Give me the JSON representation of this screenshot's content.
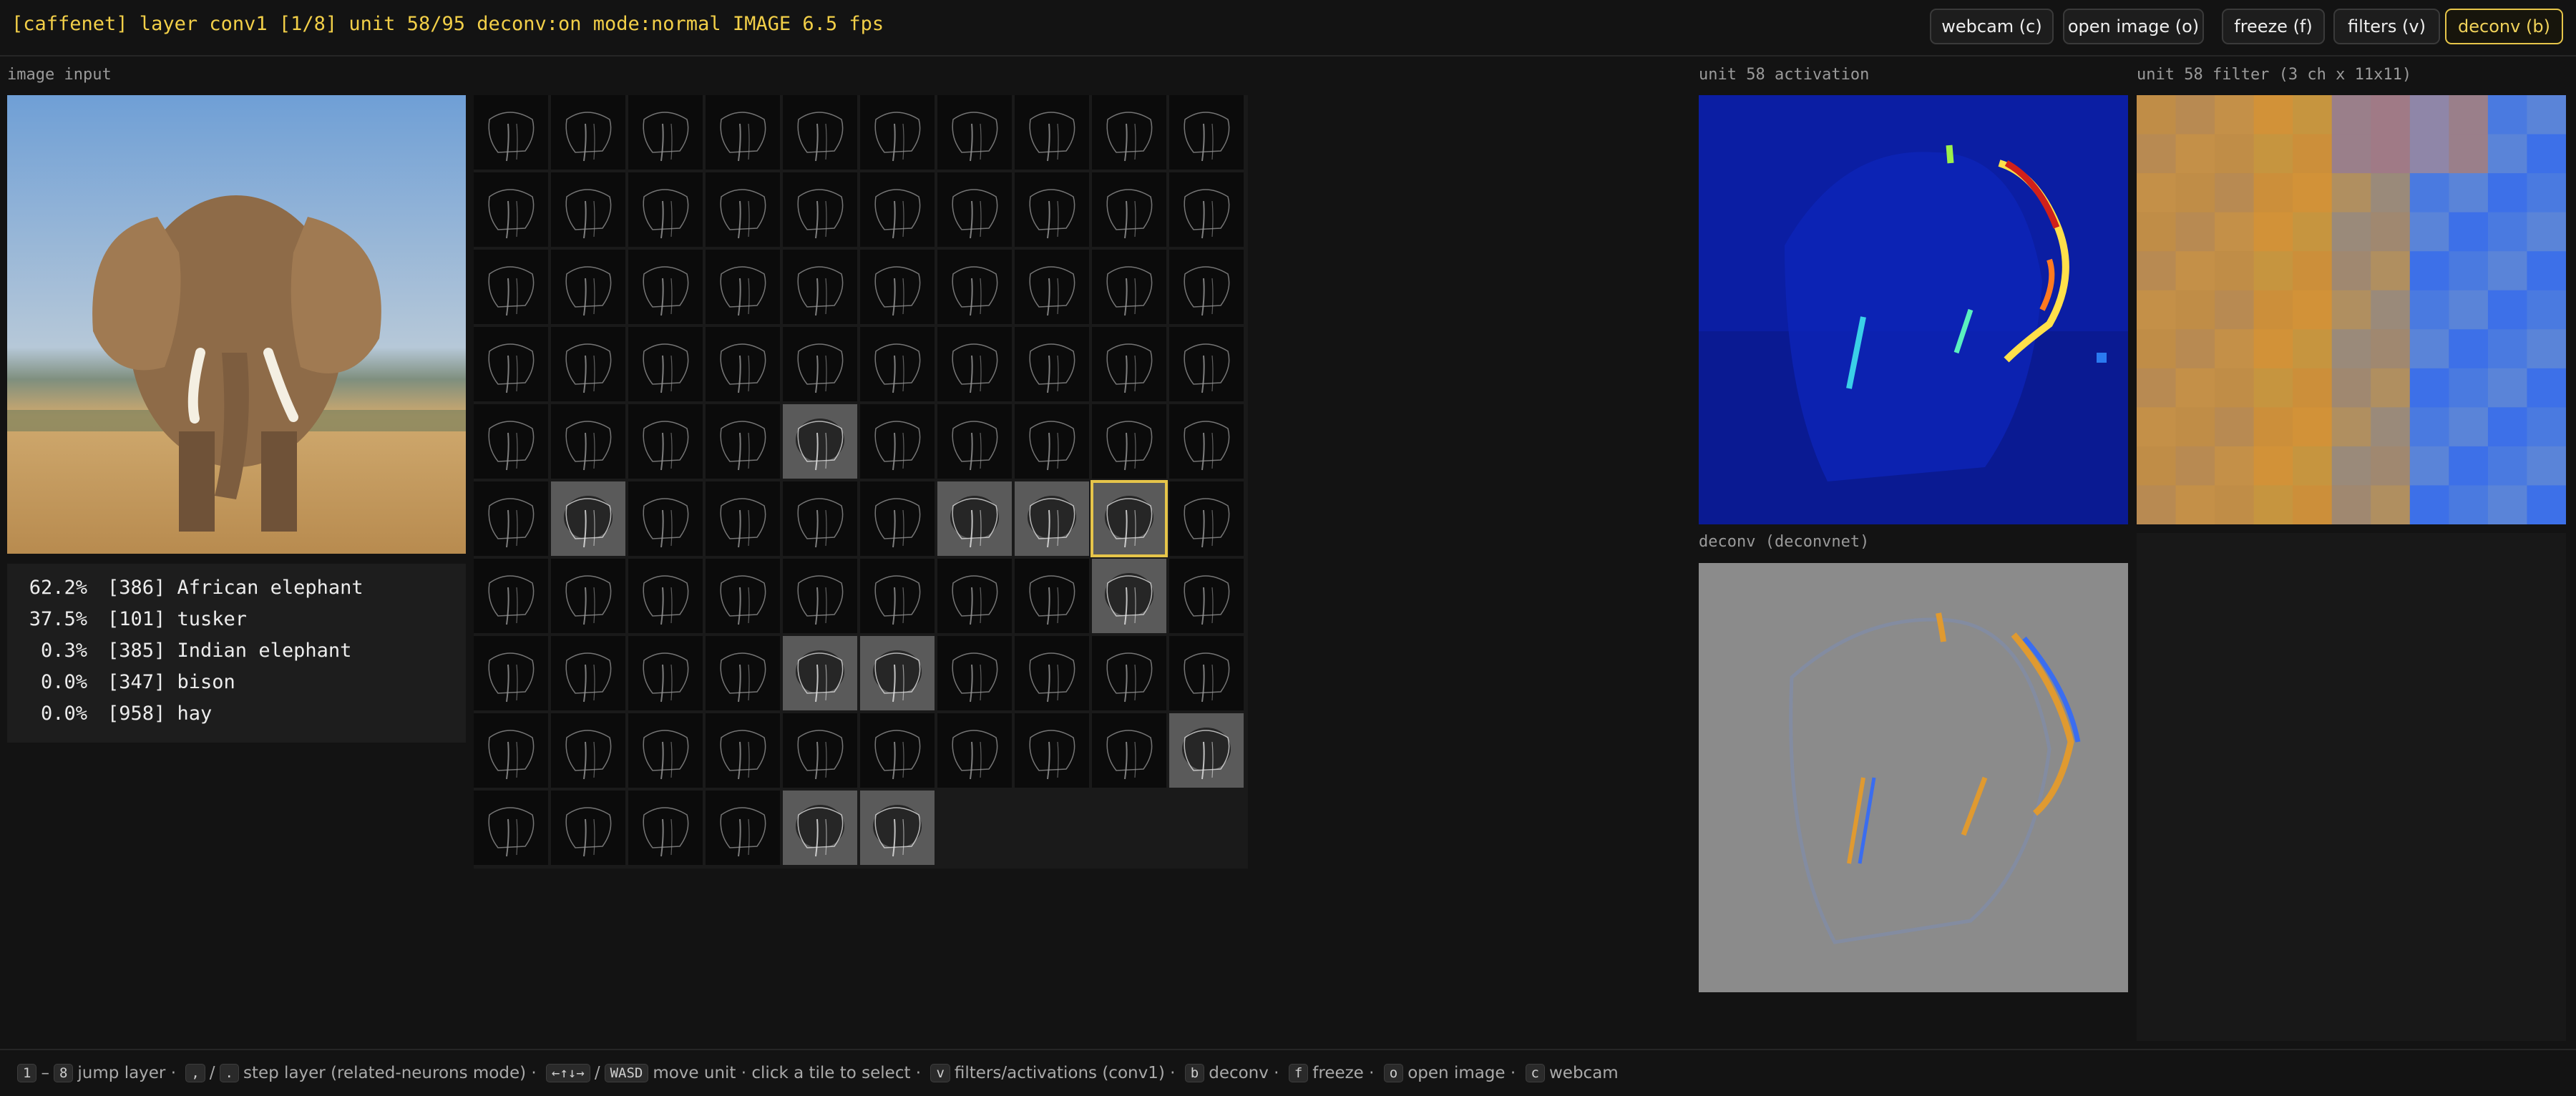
{
  "header": {
    "status": "[caffenet] layer conv1 [1/8] unit 58/95 deconv:on mode:normal IMAGE 6.5 fps",
    "buttons": [
      {
        "label": "webcam (c)",
        "active": false
      },
      {
        "label": "open image (o)",
        "active": false
      },
      {
        "label": "freeze (f)",
        "active": false
      },
      {
        "label": "filters (v)",
        "active": false
      },
      {
        "label": "deconv (b)",
        "active": true
      }
    ]
  },
  "labels": {
    "image_input": "image input",
    "activation": "unit 58 activation",
    "filter": "unit 58 filter (3 ch x 11x11)",
    "deconv": "deconv (deconvnet)"
  },
  "predictions": [
    {
      "prob": "62.2%",
      "label": "[386] African elephant"
    },
    {
      "prob": "37.5%",
      "label": "[101] tusker"
    },
    {
      "prob": "0.3%",
      "label": "[385] Indian elephant"
    },
    {
      "prob": "0.0%",
      "label": "[347] bison"
    },
    {
      "prob": "0.0%",
      "label": "[958] hay"
    }
  ],
  "grid": {
    "columns": 10,
    "unit_count": 96,
    "selected_unit": 58,
    "bright_units": [
      44,
      51,
      56,
      57,
      58,
      68,
      74,
      75,
      89,
      94,
      95
    ]
  },
  "footer": {
    "items": [
      {
        "keys": [
          "1",
          "8"
        ],
        "sep": "–",
        "text": "jump layer"
      },
      {
        "keys": [
          ",",
          "."
        ],
        "sep": "/",
        "text": "step layer (related-neurons mode)"
      },
      {
        "keys": [
          "←↑↓→",
          "WASD"
        ],
        "sep": "/",
        "text": "move unit"
      },
      {
        "keys": [],
        "sep": "",
        "text": "click a tile to select"
      },
      {
        "keys": [
          "v"
        ],
        "sep": "",
        "text": "filters/activations (conv1)"
      },
      {
        "keys": [
          "b"
        ],
        "sep": "",
        "text": "deconv"
      },
      {
        "keys": [
          "f"
        ],
        "sep": "",
        "text": "freeze"
      },
      {
        "keys": [
          "o"
        ],
        "sep": "",
        "text": "open image"
      },
      {
        "keys": [
          "c"
        ],
        "sep": "",
        "text": "webcam"
      }
    ]
  },
  "colors": {
    "accent": "#e6c54a",
    "background": "#131313",
    "heat_low": "#0a1a9a",
    "heat_high": "#d0201a"
  }
}
